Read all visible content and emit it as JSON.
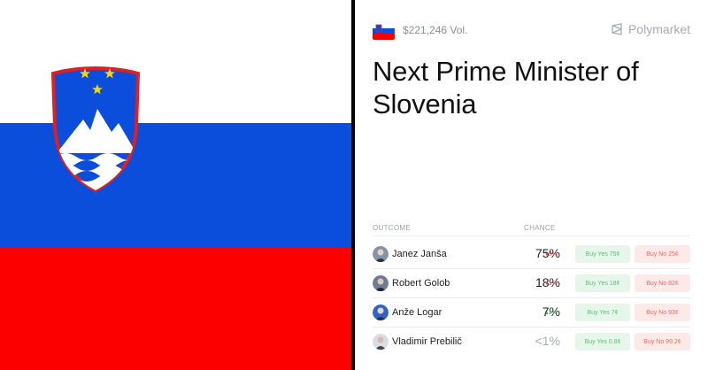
{
  "market": {
    "volume": "$221,246 Vol.",
    "brand": "Polymarket",
    "title": "Next Prime Minister of Slovenia",
    "columns": {
      "outcome": "OUTCOME",
      "chance": "CHANCE"
    },
    "outcomes": [
      {
        "name": "Janez Janša",
        "chance": "75%",
        "delta": "▾0%",
        "delta_dir": "down",
        "buy_yes": "Buy Yes 75¢",
        "buy_no": "Buy No 25¢"
      },
      {
        "name": "Robert Golob",
        "chance": "18%",
        "delta": "▾1%",
        "delta_dir": "down",
        "buy_yes": "Buy Yes 18¢",
        "buy_no": "Buy No 82¢"
      },
      {
        "name": "Anže Logar",
        "chance": "7%",
        "delta": "▴1%",
        "delta_dir": "up",
        "buy_yes": "Buy Yes 7¢",
        "buy_no": "Buy No 93¢"
      },
      {
        "name": "Vladimir Prebilič",
        "chance": "<1%",
        "delta": "",
        "delta_dir": "none",
        "buy_yes": "Buy Yes 0.8¢",
        "buy_no": "Buy No 99.2¢"
      }
    ]
  },
  "colors": {
    "flag_white": "#ffffff",
    "flag_blue": "#0b4edc",
    "flag_red": "#fc0000",
    "yes_bg": "#e6f6ea",
    "no_bg": "#fde9e8"
  },
  "icons": {
    "coat_of_arms": "slovenia-coat-of-arms",
    "brand": "polymarket-logo-icon",
    "market_flag": "slovenia-flag-icon"
  }
}
